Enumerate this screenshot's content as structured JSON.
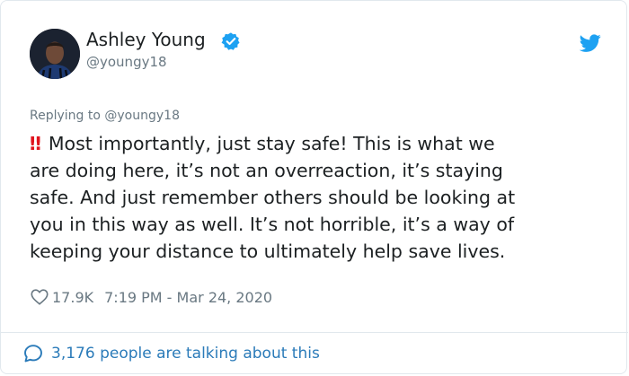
{
  "tweet": {
    "author": {
      "name": "Ashley Young",
      "handle": "@youngy18",
      "verified": true
    },
    "reply_context": {
      "prefix": "Replying to ",
      "handle": "@youngy18"
    },
    "emoji": "‼",
    "text_lines": [
      "Most importantly, just stay safe! This is what we",
      "are doing here, it’s not an overreaction, it’s staying",
      "safe. And just remember others should be looking at",
      "you in this way as well. It’s not horrible, it’s a way of",
      "keeping your distance to ultimately help save lives."
    ],
    "likes": "17.9K",
    "timestamp": "7:19 PM - Mar 24, 2020",
    "conversation": "3,176 people are talking about this"
  },
  "icons": {
    "verified": "verified-badge-icon",
    "brand": "twitter-bird-icon",
    "like": "heart-icon",
    "conversation": "speech-bubble-icon"
  },
  "colors": {
    "text": "#1c2022",
    "muted": "#697882",
    "link": "#2b7bb9",
    "brand": "#1da1f2",
    "emoji": "#e0141e",
    "border": "#e1e8ed"
  }
}
